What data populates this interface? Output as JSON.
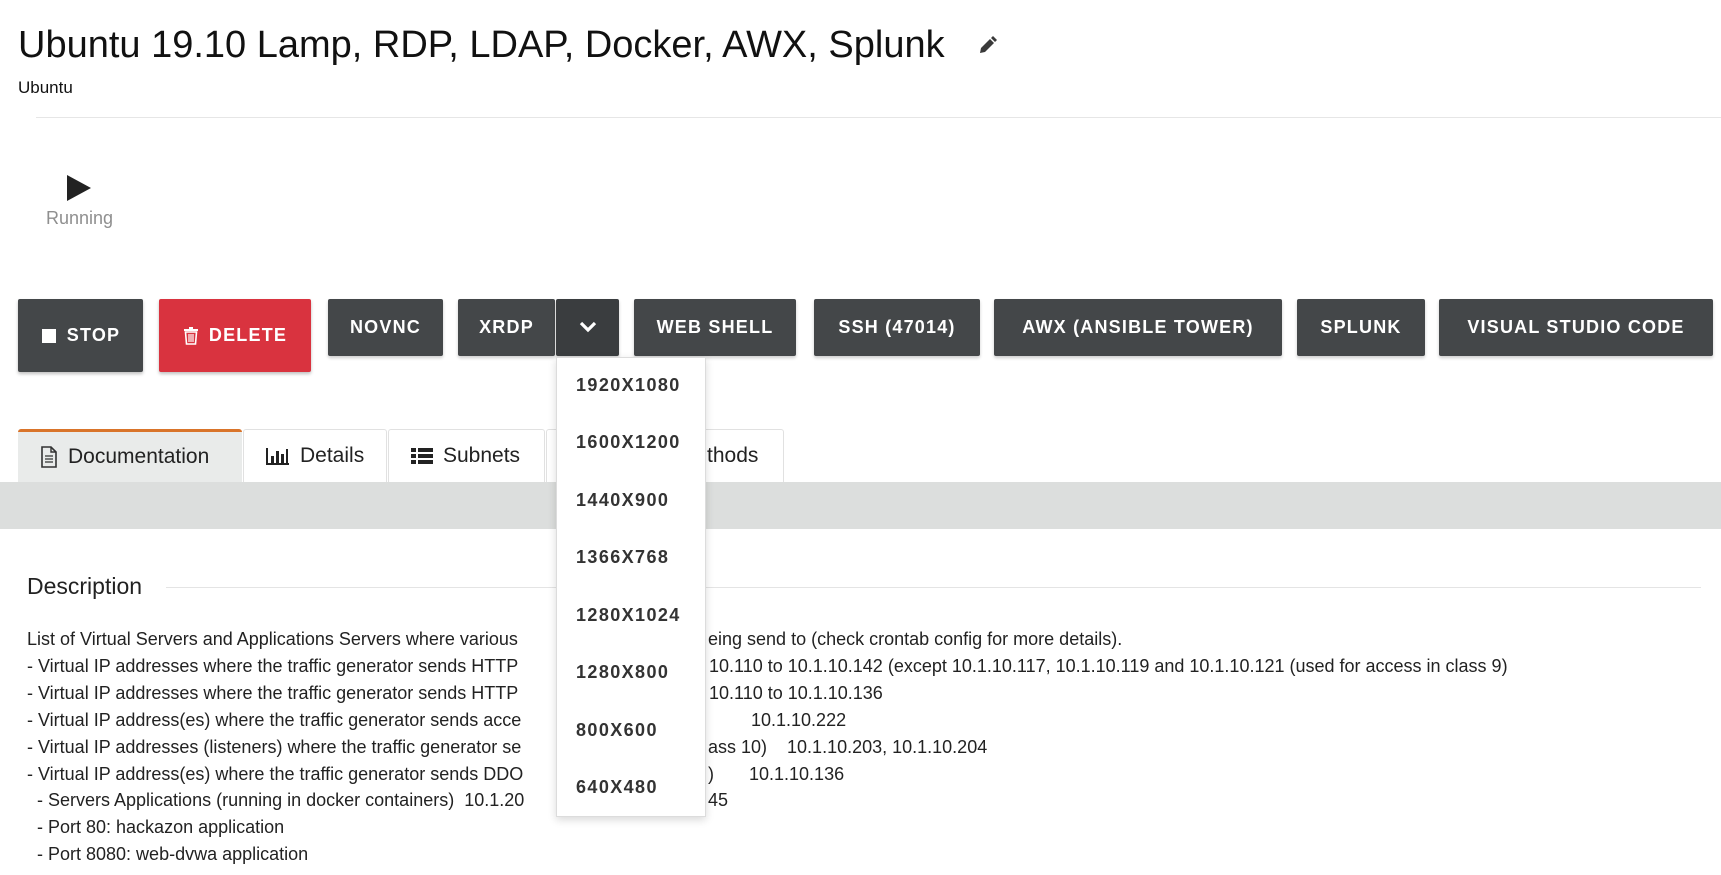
{
  "header": {
    "title": "Ubuntu 19.10 Lamp, RDP, LDAP, Docker, AWX, Splunk",
    "subtitle": "Ubuntu"
  },
  "status": {
    "label": "Running",
    "icon": "play-icon"
  },
  "actions": {
    "stop": "STOP",
    "delete": "DELETE",
    "novnc": "NOVNC",
    "xrdp": "XRDP",
    "web_shell": "WEB SHELL",
    "ssh": "SSH (47014)",
    "awx": "AWX (ANSIBLE TOWER)",
    "splunk": "SPLUNK",
    "vscode": "VISUAL STUDIO CODE"
  },
  "xrdp_dropdown": {
    "options": [
      "1920X1080",
      "1600X1200",
      "1440X900",
      "1366X768",
      "1280X1024",
      "1280X800",
      "800X600",
      "640X480"
    ]
  },
  "tabs": [
    {
      "label": "Documentation",
      "icon": "document-icon",
      "active": true
    },
    {
      "label": "Details",
      "icon": "bar-chart-icon",
      "active": false
    },
    {
      "label": "Subnets",
      "icon": "list-icon",
      "active": false
    },
    {
      "label": "thods",
      "icon": "",
      "active": false
    }
  ],
  "description": {
    "heading": "Description",
    "lines": [
      {
        "left": "List of Virtual Servers and Applications Servers where various",
        "right": "eing send to (check crontab config for more details)."
      },
      {
        "left": "- Virtual IP addresses where the traffic generator sends HTTP",
        "right": "10.110 to 10.1.10.142 (except 10.1.10.117, 10.1.10.119 and 10.1.10.121 (used for access in class 9)"
      },
      {
        "left": "- Virtual IP addresses where the traffic generator sends HTTP",
        "right": "10.110 to 10.1.10.136"
      },
      {
        "left": "- Virtual IP address(es) where the traffic generator sends acce",
        "right": "10.1.10.222"
      },
      {
        "left": "- Virtual IP addresses (listeners) where the traffic generator se",
        "right": "ass 10)    10.1.10.203, 10.1.10.204"
      },
      {
        "left": "- Virtual IP address(es) where the traffic generator sends DDO",
        "right": ")       10.1.10.136"
      },
      {
        "left": "  - Servers Applications (running in docker containers)  10.1.20",
        "right": "45"
      },
      {
        "left": "  - Port 80: hackazon application",
        "right": ""
      },
      {
        "left": "  - Port 8080: web-dvwa application",
        "right": ""
      }
    ]
  }
}
